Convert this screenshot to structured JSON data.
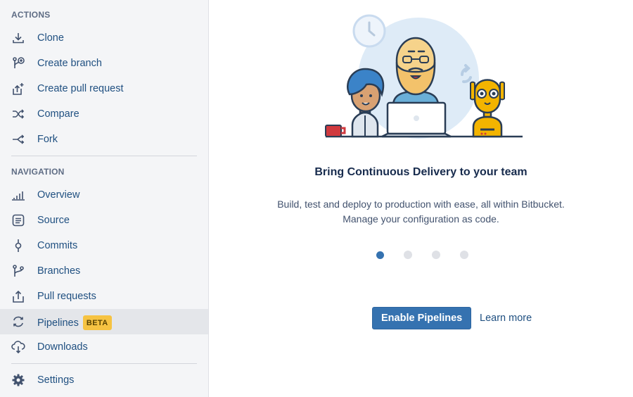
{
  "sidebar": {
    "actions_title": "ACTIONS",
    "actions": [
      {
        "label": "Clone",
        "icon": "download-icon"
      },
      {
        "label": "Create branch",
        "icon": "create-branch-icon"
      },
      {
        "label": "Create pull request",
        "icon": "create-pull-request-icon"
      },
      {
        "label": "Compare",
        "icon": "compare-icon"
      },
      {
        "label": "Fork",
        "icon": "fork-icon"
      }
    ],
    "navigation_title": "NAVIGATION",
    "navigation": [
      {
        "label": "Overview",
        "icon": "overview-icon"
      },
      {
        "label": "Source",
        "icon": "source-icon"
      },
      {
        "label": "Commits",
        "icon": "commits-icon"
      },
      {
        "label": "Branches",
        "icon": "branches-icon"
      },
      {
        "label": "Pull requests",
        "icon": "pull-requests-icon"
      },
      {
        "label": "Pipelines",
        "icon": "pipelines-icon",
        "badge": "BETA",
        "active": true
      },
      {
        "label": "Downloads",
        "icon": "downloads-cloud-icon"
      }
    ],
    "settings": {
      "label": "Settings",
      "icon": "gear-icon"
    }
  },
  "main": {
    "headline": "Bring Continuous Delivery to your team",
    "description_line1": "Build, test and deploy to production with ease, all within Bitbucket.",
    "description_line2": "Manage your configuration as code.",
    "carousel": {
      "count": 4,
      "active_index": 0
    },
    "primary_button": "Enable Pipelines",
    "secondary_link": "Learn more"
  },
  "colors": {
    "link": "#205081",
    "primary_button": "#3572b0",
    "badge_bg": "#f6c342",
    "sidebar_bg": "#f4f5f7",
    "active_item_bg": "#e4e6ea"
  }
}
